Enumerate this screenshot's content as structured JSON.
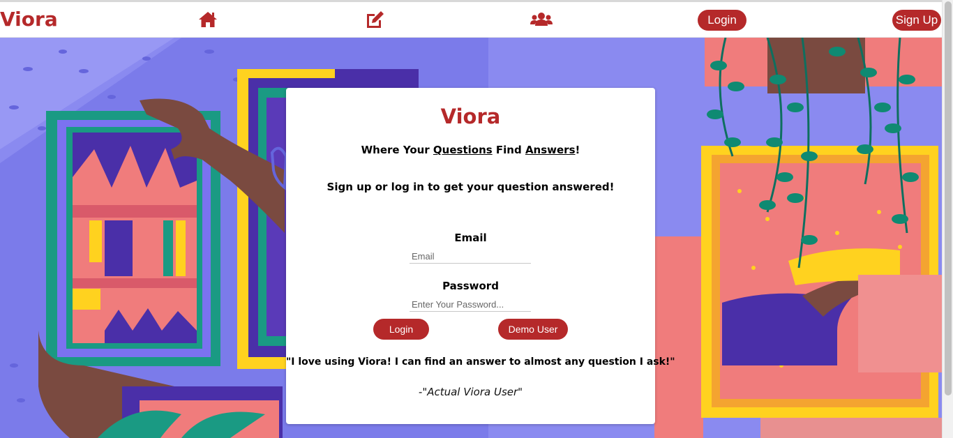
{
  "nav": {
    "brand": "Viora",
    "icons": [
      "home-icon",
      "edit-icon",
      "users-icon"
    ],
    "login_label": "Login",
    "signup_label": "Sign Up"
  },
  "card": {
    "title": "Viora",
    "tagline": {
      "prefix": "Where Your ",
      "questions": "Questions",
      "middle": " Find ",
      "answers": "Answers",
      "suffix": "!"
    },
    "subtitle": "Sign up or log in to get your question answered!",
    "email_label": "Email",
    "email_placeholder": "Email",
    "email_value": "",
    "password_label": "Password",
    "password_placeholder": "Enter Your Password...",
    "password_value": "",
    "login_button": "Login",
    "demo_button": "Demo User",
    "quote": "\"I love using Viora! I can find an answer to almost any question I ask!\"",
    "attribution": "-\"Actual Viora User\""
  },
  "colors": {
    "brand": "#b5292a",
    "hero_background": "#8a8af0"
  }
}
